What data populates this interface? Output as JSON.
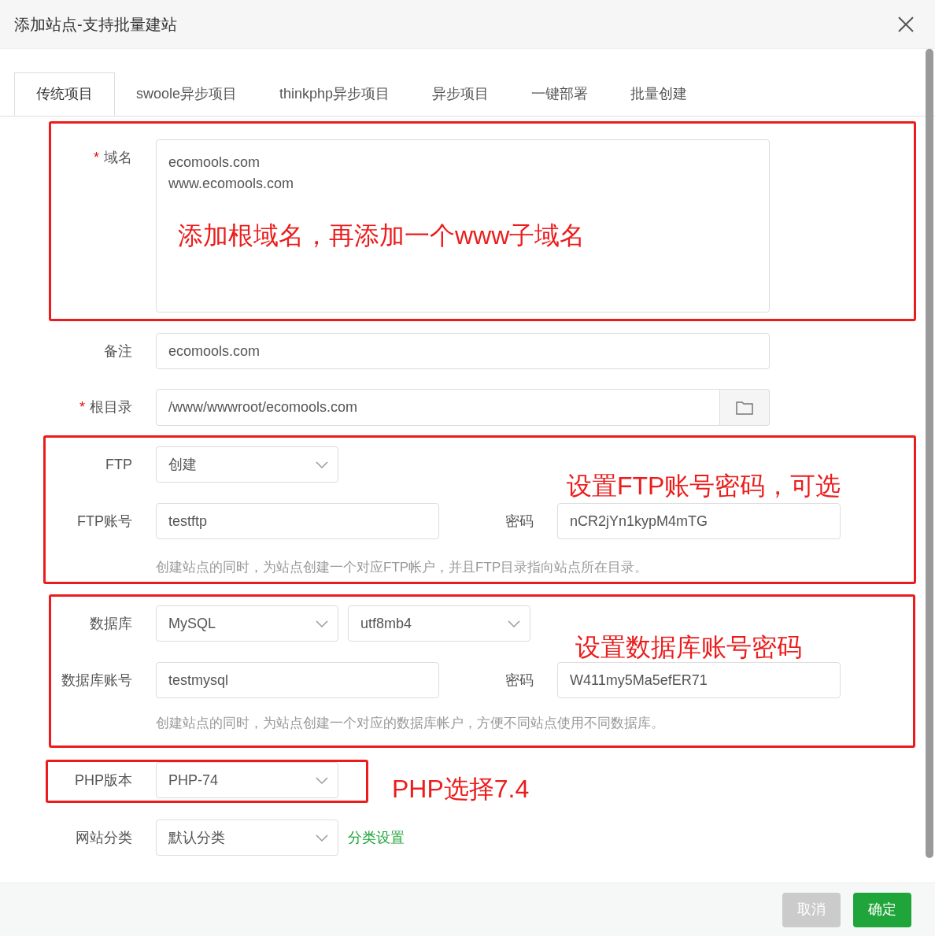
{
  "dialog": {
    "title": "添加站点-支持批量建站"
  },
  "tabs": [
    {
      "label": "传统项目",
      "selected": true
    },
    {
      "label": "swoole异步项目",
      "selected": false
    },
    {
      "label": "thinkphp异步项目",
      "selected": false
    },
    {
      "label": "异步项目",
      "selected": false
    },
    {
      "label": "一键部署",
      "selected": false
    },
    {
      "label": "批量创建",
      "selected": false
    }
  ],
  "form": {
    "domain": {
      "label": "域名",
      "required_mark": "*",
      "lines": [
        "ecomools.com",
        "www.ecomools.com"
      ]
    },
    "remark": {
      "label": "备注",
      "value": "ecomools.com"
    },
    "root_dir": {
      "label": "根目录",
      "required_mark": "*",
      "value": "/www/wwwroot/ecomools.com"
    },
    "ftp": {
      "label": "FTP",
      "value": "创建"
    },
    "ftp_account": {
      "label": "FTP账号",
      "value": "testftp"
    },
    "ftp_password": {
      "label": "密码",
      "value": "nCR2jYn1kypM4mTG"
    },
    "ftp_hint": "创建站点的同时，为站点创建一个对应FTP帐户，并且FTP目录指向站点所在目录。",
    "database": {
      "label": "数据库",
      "type": "MySQL",
      "charset": "utf8mb4"
    },
    "db_account": {
      "label": "数据库账号",
      "value": "testmysql"
    },
    "db_password": {
      "label": "密码",
      "value": "W411my5Ma5efER71"
    },
    "db_hint": "创建站点的同时，为站点创建一个对应的数据库帐户，方便不同站点使用不同数据库。",
    "php": {
      "label": "PHP版本",
      "value": "PHP-74"
    },
    "category": {
      "label": "网站分类",
      "value": "默认分类",
      "link": "分类设置"
    }
  },
  "buttons": [
    {
      "label": "取消",
      "kind": "cancel"
    },
    {
      "label": "确定",
      "kind": "confirm"
    }
  ],
  "annotations": [
    "添加根域名，再添加一个www子域名",
    "设置FTP账号密码，可选",
    "设置数据库账号密码",
    "PHP选择7.4"
  ]
}
